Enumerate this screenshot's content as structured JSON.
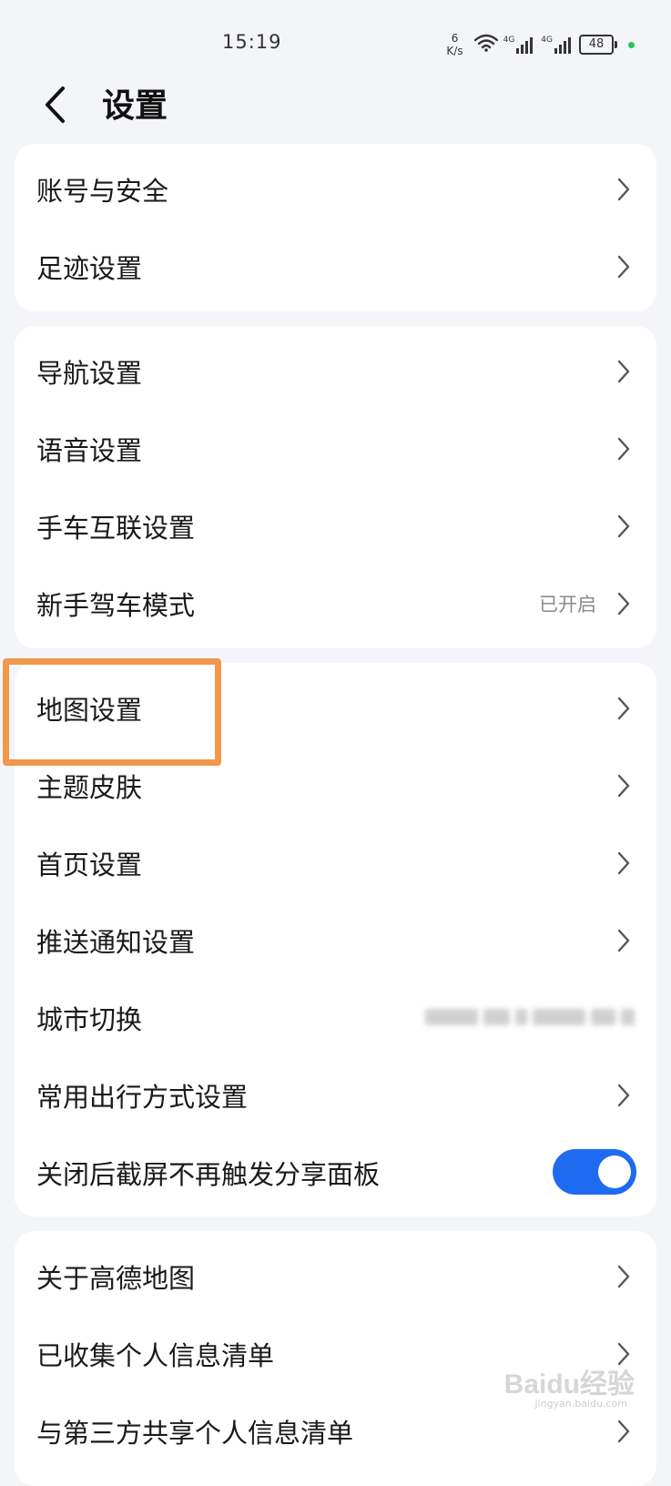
{
  "status_bar": {
    "time": "15:19",
    "net_speed_value": "6",
    "net_speed_unit": "K/s",
    "signal_label_1": "4G",
    "signal_label_2": "4G",
    "battery": "48"
  },
  "header": {
    "title": "设置"
  },
  "groups": [
    {
      "items": [
        {
          "label": "账号与安全"
        },
        {
          "label": "足迹设置"
        }
      ]
    },
    {
      "items": [
        {
          "label": "导航设置"
        },
        {
          "label": "语音设置"
        },
        {
          "label": "手车互联设置"
        },
        {
          "label": "新手驾车模式",
          "value": "已开启"
        }
      ]
    },
    {
      "items": [
        {
          "label": "地图设置"
        },
        {
          "label": "主题皮肤"
        },
        {
          "label": "首页设置"
        },
        {
          "label": "推送通知设置"
        },
        {
          "label": "城市切换"
        },
        {
          "label": "常用出行方式设置"
        },
        {
          "label": "关闭后截屏不再触发分享面板",
          "toggle_on": true
        }
      ]
    },
    {
      "items": [
        {
          "label": "关于高德地图"
        },
        {
          "label": "已收集个人信息清单"
        },
        {
          "label": "与第三方共享个人信息清单"
        }
      ]
    }
  ],
  "watermark": {
    "text": "Baidu经验",
    "sub": "jingyan.baidu.com"
  },
  "colors": {
    "background": "#f4f5f8",
    "card": "#ffffff",
    "toggle_on": "#1e6bf0",
    "highlight": "#f0974a",
    "status_dot": "#22c55e"
  }
}
